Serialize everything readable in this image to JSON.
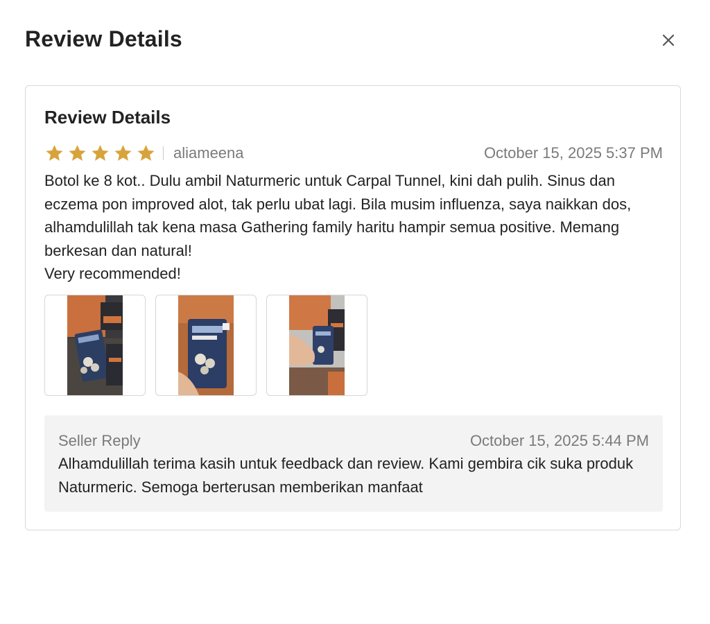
{
  "modal": {
    "title": "Review Details",
    "close_icon": "close-icon"
  },
  "review": {
    "section_title": "Review Details",
    "rating": 5,
    "rating_max": 5,
    "star_color": "#d8a33b",
    "reviewer": "aliameena",
    "date": "October 15, 2025 5:37 PM",
    "text_lines": [
      "Botol ke 8 kot.. Dulu ambil Naturmeric untuk Carpal Tunnel, kini dah pulih. Sinus dan eczema pon improved alot, tak perlu ubat lagi. Bila musim influenza, saya naikkan dos, alhamdulillah tak kena masa Gathering family haritu hampir semua positive. Memang berkesan dan natural!",
      "Very recommended!"
    ],
    "photos": [
      {
        "name": "review-photo-1"
      },
      {
        "name": "review-photo-2"
      },
      {
        "name": "review-photo-3"
      }
    ]
  },
  "seller_reply": {
    "label": "Seller Reply",
    "date": "October 15, 2025 5:44 PM",
    "text": "Alhamdulillah terima kasih untuk feedback dan review. Kami gembira cik suka produk Naturmeric. Semoga berterusan memberikan manfaat"
  }
}
